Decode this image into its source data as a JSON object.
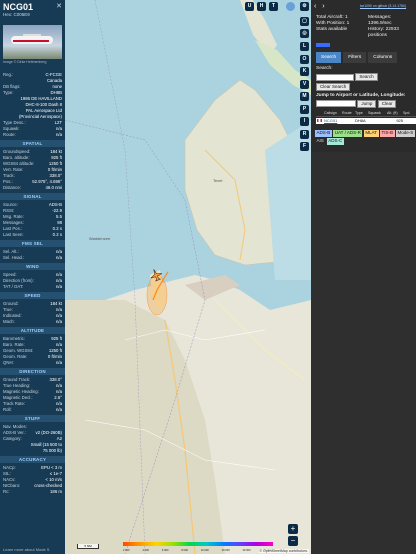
{
  "left": {
    "callsign": "NCG01",
    "close": "✕",
    "hex": "Hex: C005E9",
    "photo_credit": "Image © Dirke Heitmenberg",
    "info": [
      {
        "label": "Reg.:",
        "value": "C-FCGE"
      },
      {
        "label": "",
        "value": "Canada"
      },
      {
        "label": "DB flags:",
        "value": "none"
      },
      {
        "label": "Type:",
        "value": "DH8B"
      },
      {
        "label": "",
        "value": "1986 DE HAVILLAND"
      },
      {
        "label": "",
        "value": "DHC-8-100 Dash 8"
      },
      {
        "label": "",
        "value": "PAL Aerospace Ltd"
      },
      {
        "label": "",
        "value": "(Provincial Aerospace)"
      },
      {
        "label": "Type Desc.:",
        "value": "L2T"
      },
      {
        "label": "Squawk:",
        "value": "n/a"
      },
      {
        "label": "Route:",
        "value": "n/a"
      }
    ],
    "sections": [
      {
        "title": "SPATIAL",
        "rows": [
          {
            "label": "Groundspeed:",
            "value": "184 kt"
          },
          {
            "label": "Baro. altitude:",
            "value": "925 ft"
          },
          {
            "label": "WGS84 altitude:",
            "value": "1250 ft"
          },
          {
            "label": "Vert. Rate:",
            "value": "0 ft/min"
          },
          {
            "label": "Track:",
            "value": "338.0°"
          },
          {
            "label": "Pos.:",
            "value": "52.975°, 4.696°"
          },
          {
            "label": "Distance:",
            "value": "46.0 nmi"
          }
        ]
      },
      {
        "title": "SIGNAL",
        "rows": [
          {
            "label": "Source:",
            "value": "ADS-B"
          },
          {
            "label": "RSSI:",
            "value": "-22.9"
          },
          {
            "label": "Msg. Rate:",
            "value": "5.5"
          },
          {
            "label": "Messages:",
            "value": "98"
          },
          {
            "label": "Last Pos.:",
            "value": "0.2 s"
          },
          {
            "label": "Last Seen:",
            "value": "0.2 s"
          }
        ]
      },
      {
        "title": "FMS SEL",
        "rows": [
          {
            "label": "Sel. Alt.:",
            "value": "n/a"
          },
          {
            "label": "Sel. Head.:",
            "value": "n/a"
          }
        ]
      },
      {
        "title": "WIND",
        "rows": [
          {
            "label": "Speed:",
            "value": "n/a"
          },
          {
            "label": "Direction (from):",
            "value": "n/a"
          },
          {
            "label": "TAT / OAT:",
            "value": "n/a"
          }
        ]
      },
      {
        "title": "SPEED",
        "rows": [
          {
            "label": "Ground:",
            "value": "184 kt"
          },
          {
            "label": "True:",
            "value": "n/a"
          },
          {
            "label": "Indicated:",
            "value": "n/a"
          },
          {
            "label": "Mach:",
            "value": "n/a"
          }
        ]
      },
      {
        "title": "ALTITUDE",
        "rows": [
          {
            "label": "Barometric:",
            "value": "925 ft"
          },
          {
            "label": "Baro. Rate:",
            "value": "n/a"
          },
          {
            "label": "Geom. WGS84:",
            "value": "1250 ft"
          },
          {
            "label": "Geom. Rate:",
            "value": "0 ft/min"
          },
          {
            "label": "QNH:",
            "value": "n/a"
          }
        ]
      },
      {
        "title": "DIRECTION",
        "rows": [
          {
            "label": "Ground Track:",
            "value": "338.0°"
          },
          {
            "label": "True Heading:",
            "value": "n/a"
          },
          {
            "label": "Magnetic Heading:",
            "value": "n/a"
          },
          {
            "label": "Magnetic Decl.:",
            "value": "2.6°"
          },
          {
            "label": "Track Rate:",
            "value": "n/a"
          },
          {
            "label": "Roll:",
            "value": "n/a"
          }
        ]
      },
      {
        "title": "STUFF",
        "rows": [
          {
            "label": "Nav. Modes:",
            "value": ""
          },
          {
            "label": "ADS-B Ver.:",
            "value": "v2 (DO-260B)"
          },
          {
            "label": "Category:",
            "value": "A2"
          },
          {
            "label": "",
            "value": "Small (15 500 to"
          },
          {
            "label": "",
            "value": "75 000 lb)"
          }
        ]
      },
      {
        "title": "ACCURACY",
        "rows": [
          {
            "label": "NACp:",
            "value": "EPU < 3 m"
          },
          {
            "label": "SIL:",
            "value": "≤ 1e-7"
          },
          {
            "label": "NACv:",
            "value": "< 10 m/s"
          },
          {
            "label": "NICbaro:",
            "value": "cross-checked"
          },
          {
            "label": "Rc:",
            "value": "186 m"
          }
        ]
      }
    ],
    "footer": "Learn more about Mode S"
  },
  "map": {
    "top_buttons": [
      "U",
      "H",
      "T"
    ],
    "side_buttons": [
      "L",
      "O",
      "K",
      "V",
      "M",
      "P",
      "I",
      "R",
      "F"
    ],
    "zoom_in": "+",
    "zoom_out": "−",
    "scale_label": "5 NM",
    "colorbar_labels": [
      "2 000",
      "4 000",
      "6 000",
      "8 000",
      "10 000",
      "20 000",
      "30 000",
      "40 000+"
    ],
    "attribution": "© OpenStreetMap contributors.",
    "labels": {
      "texel": "Texel",
      "wadden": "Waddenzee"
    },
    "aircraft_track_deg": 338.0
  },
  "right": {
    "arrows": "‹ ›",
    "version": "tar1090 on github (3.14.1780)",
    "stats": {
      "total": "Total Aircraft: 1",
      "with_position": "With Position: 1",
      "stats_available": "Stats available",
      "messages_label": "Messages:",
      "messages_value": "1396.9/sec",
      "history": "History: 22933",
      "history_unit": "positions"
    },
    "tabs": [
      "Search",
      "Filters",
      "Columns"
    ],
    "search": {
      "label": "Search:",
      "button": "Search",
      "clear": "Clear Search",
      "jump_label": "Jump to Airport or Latitude, Longitude:",
      "jump_button": "Jump",
      "clear2": "Clear"
    },
    "table_headers": [
      "",
      "Callsign",
      "Route",
      "Type",
      "Squawk",
      "Alt. (ft)",
      "Spd."
    ],
    "table_row": {
      "callsign": "NCG01",
      "route": "",
      "type": "DH8A",
      "squawk": "",
      "alt": "925",
      "spd": ""
    },
    "chips": [
      {
        "label": "ADS-B",
        "color": "#9ac0ff"
      },
      {
        "label": "UAT / ADS-R",
        "color": "#9ae08a"
      },
      {
        "label": "MLAT",
        "color": "#ffd27a"
      },
      {
        "label": "TIS-B",
        "color": "#ffa6a6"
      },
      {
        "label": "Mode-S",
        "color": "#cfcfcf"
      },
      {
        "label": "AIS",
        "color": ""
      },
      {
        "label": "ADS-C",
        "color": "#a6e8d8"
      }
    ]
  }
}
